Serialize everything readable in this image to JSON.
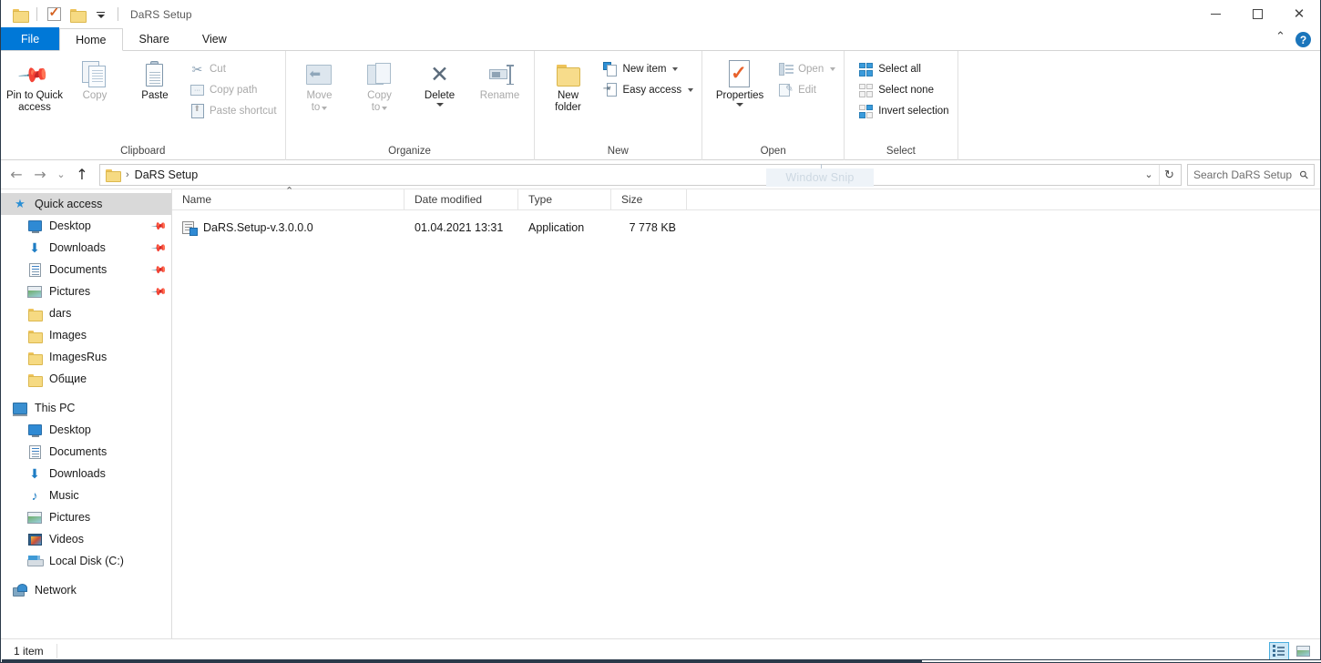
{
  "window": {
    "title": "DaRS Setup",
    "quick_access_icons": [
      "folder-icon",
      "properties-checkbox-icon",
      "new-folder-icon",
      "customize-caret-icon"
    ],
    "controls": {
      "minimize": "—",
      "maximize": "□",
      "close": "✕"
    }
  },
  "tabs": [
    {
      "id": "file",
      "label": "File"
    },
    {
      "id": "home",
      "label": "Home"
    },
    {
      "id": "share",
      "label": "Share"
    },
    {
      "id": "view",
      "label": "View"
    }
  ],
  "tab_right": {
    "collapse": "⌃",
    "help": "?"
  },
  "ribbon": {
    "groups": [
      {
        "name": "Clipboard",
        "label": "Clipboard",
        "big_buttons": [
          {
            "name": "pin-to-quick-access",
            "label": "Pin to Quick\naccess",
            "line1": "Pin to Quick",
            "line2": "access",
            "icon": "pin-icon",
            "disabled": false
          },
          {
            "name": "copy",
            "label": "Copy",
            "icon": "copy-icon",
            "disabled": true
          },
          {
            "name": "paste",
            "label": "Paste",
            "icon": "paste-icon",
            "disabled": false
          }
        ],
        "small_buttons": [
          {
            "name": "cut",
            "label": "Cut",
            "icon": "scissors-icon",
            "disabled": true
          },
          {
            "name": "copy-path",
            "label": "Copy path",
            "icon": "copy-path-icon",
            "disabled": true
          },
          {
            "name": "paste-shortcut",
            "label": "Paste shortcut",
            "icon": "paste-shortcut-icon",
            "disabled": true
          }
        ]
      },
      {
        "name": "Organize",
        "label": "Organize",
        "big_buttons": [
          {
            "name": "move-to",
            "line1": "Move",
            "line2": "to",
            "icon": "move-to-icon",
            "disabled": true,
            "caret": true
          },
          {
            "name": "copy-to",
            "line1": "Copy",
            "line2": "to",
            "icon": "copy-to-icon",
            "disabled": true,
            "caret": true
          },
          {
            "name": "delete",
            "line1": "Delete",
            "line2": "",
            "icon": "delete-icon",
            "disabled": false,
            "caret": true
          },
          {
            "name": "rename",
            "line1": "Rename",
            "line2": "",
            "icon": "rename-icon",
            "disabled": true,
            "caret": false
          }
        ],
        "small_buttons": []
      },
      {
        "name": "New",
        "label": "New",
        "big_buttons": [
          {
            "name": "new-folder",
            "line1": "New",
            "line2": "folder",
            "icon": "new-folder-icon",
            "disabled": false
          }
        ],
        "small_buttons": [
          {
            "name": "new-item",
            "label": "New item",
            "icon": "new-item-icon",
            "disabled": false,
            "caret": true
          },
          {
            "name": "easy-access",
            "label": "Easy access",
            "icon": "easy-access-icon",
            "disabled": false,
            "caret": true
          }
        ]
      },
      {
        "name": "Open",
        "label": "Open",
        "big_buttons": [
          {
            "name": "properties",
            "line1": "Properties",
            "line2": "",
            "icon": "properties-icon",
            "disabled": false,
            "caret": true
          }
        ],
        "small_buttons": [
          {
            "name": "open",
            "label": "Open",
            "icon": "open-icon",
            "disabled": true,
            "caret": true
          },
          {
            "name": "edit",
            "label": "Edit",
            "icon": "edit-icon",
            "disabled": true,
            "caret": false
          }
        ]
      },
      {
        "name": "Select",
        "label": "Select",
        "big_buttons": [],
        "small_buttons": [
          {
            "name": "select-all",
            "label": "Select all",
            "icon": "select-all-icon",
            "disabled": false
          },
          {
            "name": "select-none",
            "label": "Select none",
            "icon": "select-none-icon",
            "disabled": false
          },
          {
            "name": "invert-selection",
            "label": "Invert selection",
            "icon": "invert-selection-icon",
            "disabled": false
          }
        ]
      }
    ]
  },
  "overlay": {
    "snip_label": "Window Snip"
  },
  "addressbar": {
    "back": "←",
    "forward": "→",
    "recent": "⌄",
    "up": "↑",
    "crumb_root_icon": "folder-icon",
    "crumb_separator": "›",
    "crumb": "DaRS Setup",
    "history_caret": "⌄",
    "refresh": "↻"
  },
  "search": {
    "placeholder": "Search DaRS Setup",
    "icon": "search-icon"
  },
  "navpane": {
    "quick_access": {
      "name": "quick-access",
      "label": "Quick access",
      "icon": "star-pin-icon",
      "selected": true,
      "children": [
        {
          "name": "desktop",
          "label": "Desktop",
          "icon": "desktop-icon",
          "pinned": true
        },
        {
          "name": "downloads",
          "label": "Downloads",
          "icon": "download-icon",
          "pinned": true
        },
        {
          "name": "documents",
          "label": "Documents",
          "icon": "documents-icon",
          "pinned": true
        },
        {
          "name": "pictures",
          "label": "Pictures",
          "icon": "pictures-icon",
          "pinned": true
        },
        {
          "name": "dars",
          "label": "dars",
          "icon": "folder-icon",
          "pinned": false
        },
        {
          "name": "images",
          "label": "Images",
          "icon": "folder-icon",
          "pinned": false
        },
        {
          "name": "imagesrus",
          "label": "ImagesRus",
          "icon": "folder-icon",
          "pinned": false
        },
        {
          "name": "obshie",
          "label": "Общие",
          "icon": "folder-icon",
          "pinned": false
        }
      ]
    },
    "this_pc": {
      "name": "this-pc",
      "label": "This PC",
      "icon": "pc-icon",
      "children": [
        {
          "name": "desktop",
          "label": "Desktop",
          "icon": "desktop-icon"
        },
        {
          "name": "documents",
          "label": "Documents",
          "icon": "documents-icon"
        },
        {
          "name": "downloads",
          "label": "Downloads",
          "icon": "download-icon"
        },
        {
          "name": "music",
          "label": "Music",
          "icon": "music-icon"
        },
        {
          "name": "pictures",
          "label": "Pictures",
          "icon": "pictures-icon"
        },
        {
          "name": "videos",
          "label": "Videos",
          "icon": "videos-icon"
        },
        {
          "name": "local-disk-c",
          "label": "Local Disk (C:)",
          "icon": "disk-icon"
        }
      ]
    },
    "network": {
      "name": "network",
      "label": "Network",
      "icon": "network-icon"
    }
  },
  "filelist": {
    "columns": [
      {
        "key": "name",
        "label": "Name",
        "sorted": true,
        "sort_dir": "asc"
      },
      {
        "key": "date",
        "label": "Date modified"
      },
      {
        "key": "type",
        "label": "Type"
      },
      {
        "key": "size",
        "label": "Size"
      }
    ],
    "sort_glyph": "⌃",
    "rows": [
      {
        "name": "DaRS.Setup-v.3.0.0.0",
        "date": "01.04.2021 13:31",
        "type": "Application",
        "size": "7 778 KB",
        "icon": "installer-icon"
      }
    ]
  },
  "statusbar": {
    "item_count": "1 item",
    "views": [
      {
        "name": "details-view",
        "icon": "details-view-icon",
        "active": true
      },
      {
        "name": "large-icons-view",
        "icon": "thumbnail-view-icon",
        "active": false
      }
    ]
  }
}
